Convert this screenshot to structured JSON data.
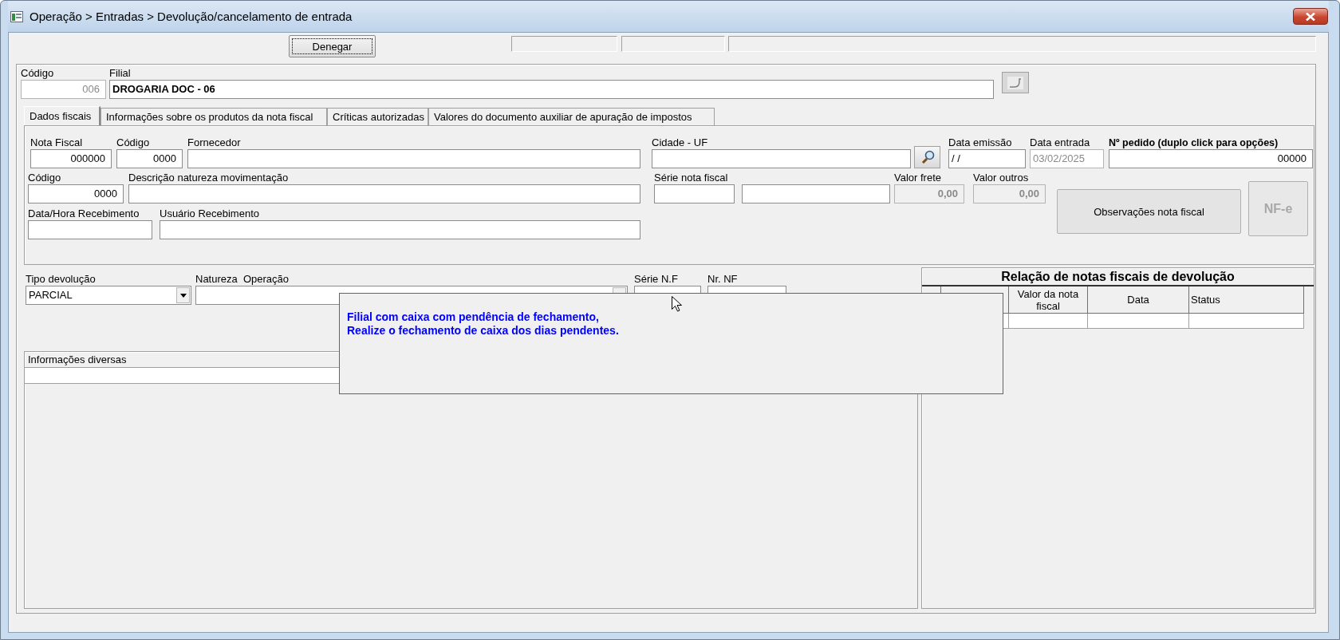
{
  "window": {
    "title": "Operação > Entradas > Devolução/cancelamento de entrada"
  },
  "toolbar": {
    "button": {
      "label": "Denegar",
      "focused": true
    }
  },
  "header": {
    "fields": [
      {
        "label": "Código",
        "value": "006",
        "disabled": true
      },
      {
        "label": "Filial",
        "value": "DROGARIA DOC - 06",
        "disabled": false
      }
    ]
  },
  "tabs": [
    {
      "label": "Dados fiscais",
      "selected": true
    },
    {
      "label": "Informações sobre os produtos da nota fiscal",
      "selected": false
    },
    {
      "label": "Críticas autorizadas",
      "selected": false
    },
    {
      "label": "Valores do documento auxiliar de apuração de impostos",
      "selected": false
    }
  ],
  "fiscal_data": {
    "rows": [
      {
        "fields": [
          {
            "label": "Nota Fiscal",
            "value": "000000",
            "disabled": false
          },
          {
            "label": "Código",
            "value": "0000",
            "disabled": false
          },
          {
            "label": "Fornecedor",
            "disabled": false
          },
          {
            "label": "Cidade - UF",
            "disabled": false
          },
          {
            "label": "Data emissão",
            "value": "/ /",
            "disabled": false
          },
          {
            "label": "Data entrada",
            "value": "03/02/2025",
            "disabled": true
          },
          {
            "label": "Nº pedido (duplo click para opções)",
            "value": "00000",
            "disabled": false
          }
        ]
      },
      {
        "fields": [
          {
            "label": "Código",
            "value": "0000",
            "disabled": false
          },
          {
            "label": "Descrição natureza movimentação",
            "disabled": false
          },
          {
            "label": "Série nota fiscal",
            "disabled": false
          },
          {
            "disabled": false
          },
          {
            "label": "Valor frete",
            "value": "0,00",
            "disabled": true
          },
          {
            "label": "Valor outros",
            "value": "0,00",
            "disabled": true
          }
        ]
      },
      {
        "fields": [
          {
            "label": "Data/Hora Recebimento",
            "disabled": false
          },
          {
            "label": "Usuário Recebimento",
            "disabled": false
          }
        ]
      }
    ],
    "buttons": [
      {
        "label": "Observações nota fiscal",
        "disabled": false
      },
      {
        "label": "NF-e",
        "disabled": true
      }
    ]
  },
  "return_fields": [
    {
      "label": "Tipo devolução",
      "value": "PARCIAL",
      "kind": "combo"
    },
    {
      "label": "Natureza  Operação",
      "kind": "combo"
    },
    {
      "label": "Série N.F",
      "kind": "text"
    },
    {
      "label": "Nr. NF",
      "kind": "text"
    }
  ],
  "other_info": {
    "title": "Informações diversas"
  },
  "returns_table": {
    "title": "Relação de notas fiscais de devolução",
    "columns": [
      {
        "label": "Valor da nota fiscal"
      },
      {
        "label": "Data"
      },
      {
        "label": "Status"
      }
    ]
  },
  "message": {
    "lines": [
      "Filial com caixa com pendência de fechamento,",
      "Realize o fechamento de caixa dos dias pendentes."
    ]
  }
}
